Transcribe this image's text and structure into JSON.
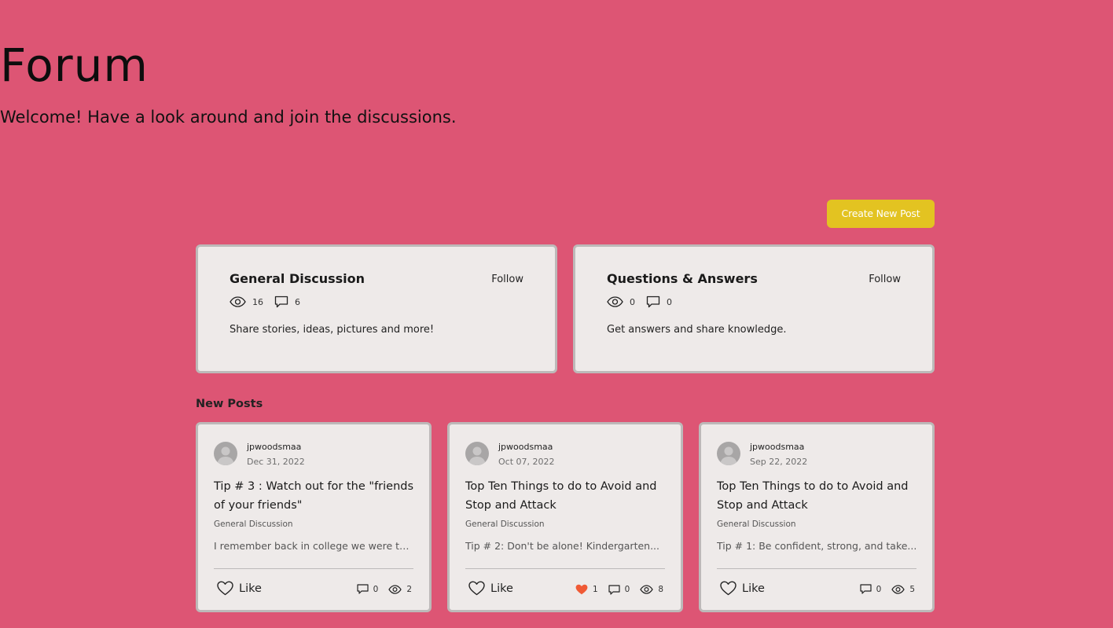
{
  "header": {
    "title": "Forum",
    "subtitle": "Welcome! Have a look around and join the discussions."
  },
  "toolbar": {
    "create_post_label": "Create New Post"
  },
  "colors": {
    "background": "#dd5574",
    "accent_button": "#e3c321",
    "card": "#eeeae9",
    "liked_heart": "#f05a35"
  },
  "categories": [
    {
      "name": "General Discussion",
      "follow_label": "Follow",
      "views": "16",
      "comments": "6",
      "description": "Share stories, ideas, pictures and more!"
    },
    {
      "name": "Questions & Answers",
      "follow_label": "Follow",
      "views": "0",
      "comments": "0",
      "description": "Get answers and share knowledge."
    }
  ],
  "new_posts": {
    "label": "New Posts",
    "items": [
      {
        "author": "jpwoodsmaa",
        "date": "Dec 31, 2022",
        "title": "Tip # 3 : Watch out for the \"friends of your friends\"",
        "category": "General Discussion",
        "excerpt": "I remember back in college we were tol...",
        "like_label": "Like",
        "likes": "",
        "comments": "0",
        "views": "2"
      },
      {
        "author": "jpwoodsmaa",
        "date": "Oct 07, 2022",
        "title": "Top Ten Things to do to Avoid and Stop and Attack",
        "category": "General Discussion",
        "excerpt": "Tip # 2: Don't be alone! Kindergarten...",
        "like_label": "Like",
        "likes": "1",
        "comments": "0",
        "views": "8"
      },
      {
        "author": "jpwoodsmaa",
        "date": "Sep 22, 2022",
        "title": "Top Ten Things to do to Avoid and Stop and Attack",
        "category": "General Discussion",
        "excerpt": "Tip # 1: Be confident, strong, and take...",
        "like_label": "Like",
        "likes": "",
        "comments": "0",
        "views": "5"
      }
    ]
  }
}
